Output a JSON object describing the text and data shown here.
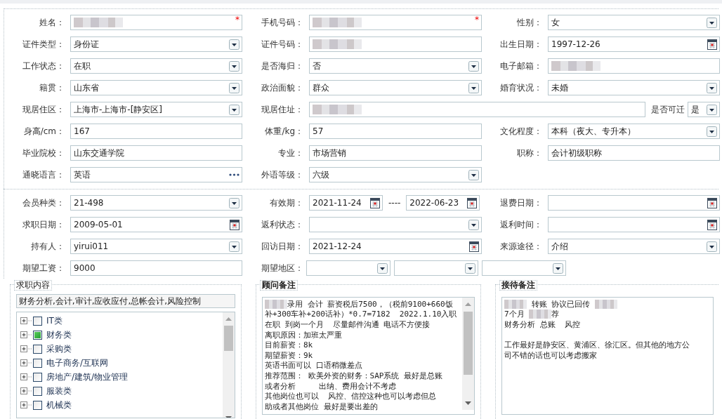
{
  "personal": {
    "fields": [
      {
        "label": "姓名：",
        "kind": "text",
        "redacted": true,
        "marker": "*"
      },
      {
        "label": "手机号码：",
        "kind": "text",
        "redacted": true,
        "marker": "*"
      },
      {
        "label": "性别：",
        "kind": "select",
        "value": "女"
      },
      {
        "label": "证件类型：",
        "kind": "select",
        "value": "身份证"
      },
      {
        "label": "证件号码：",
        "kind": "text",
        "redacted": true
      },
      {
        "label": "出生日期：",
        "kind": "date",
        "value": "1997-12-26"
      },
      {
        "label": "工作状态：",
        "kind": "select",
        "value": "在职"
      },
      {
        "label": "是否海归：",
        "kind": "select",
        "value": "否"
      },
      {
        "label": "电子邮箱：",
        "kind": "text",
        "redacted": true
      },
      {
        "label": "籍贯：",
        "kind": "select",
        "value": "山东省"
      },
      {
        "label": "政治面貌：",
        "kind": "select",
        "value": "群众"
      },
      {
        "label": "婚育状况：",
        "kind": "select",
        "value": "未婚"
      },
      {
        "label": "现居住区：",
        "kind": "select",
        "value": "上海市-上海市-[静安区]"
      },
      {
        "label": "现居住址：",
        "kind": "text",
        "redacted": true,
        "wide": true,
        "suffix": {
          "label": "是否可迁",
          "kind": "select",
          "value": "是"
        }
      },
      {
        "label": "身高/cm：",
        "kind": "text",
        "value": "167"
      },
      {
        "label": "体重/kg：",
        "kind": "text",
        "value": "57"
      },
      {
        "label": "文化程度：",
        "kind": "select",
        "value": "本科（夜大、专升本）"
      },
      {
        "label": "毕业院校：",
        "kind": "text",
        "value": "山东交通学院"
      },
      {
        "label": "专业：",
        "kind": "text",
        "value": "市场营销"
      },
      {
        "label": "职称：",
        "kind": "text",
        "value": "会计初级职称"
      },
      {
        "label": "通晓语言：",
        "kind": "picker",
        "value": "英语"
      },
      {
        "label": "外语等级：",
        "kind": "select",
        "value": "六级"
      }
    ]
  },
  "membership": {
    "fields": [
      {
        "label": "会员种类：",
        "kind": "select",
        "value": "21-498"
      },
      {
        "label": "有效期：",
        "kind": "daterange",
        "values": [
          "2021-11-24",
          "2022-06-23"
        ],
        "separator": "----"
      },
      {
        "label": "退费日期：",
        "kind": "date"
      },
      {
        "label": "求职日期：",
        "kind": "date",
        "value": "2009-05-01"
      },
      {
        "label": "返利状态：",
        "kind": "select"
      },
      {
        "label": "返利时间：",
        "kind": "date"
      },
      {
        "label": "持有人：",
        "kind": "select",
        "value": "yirui011"
      },
      {
        "label": "回访日期：",
        "kind": "date",
        "value": "2021-12-24"
      },
      {
        "label": "来源途径：",
        "kind": "select",
        "value": "介绍"
      },
      {
        "label": "期望工资：",
        "kind": "text",
        "value": "9000"
      },
      {
        "label": "期望地区：",
        "kind": "selects",
        "boxes": [
          {
            "kind": "select"
          },
          {
            "kind": "select"
          },
          {
            "kind": "select"
          }
        ]
      }
    ]
  },
  "job_content": {
    "title": "求职内容",
    "summary": "财务分析,会计,审计,应收应付,总帐会计,风险控制",
    "tree": [
      {
        "label": "IT类",
        "checked": false,
        "expanded": false
      },
      {
        "label": "财务类",
        "checked": true,
        "expanded": false
      },
      {
        "label": "采购类",
        "checked": false,
        "expanded": false
      },
      {
        "label": "电子商务/互联网",
        "checked": false,
        "expanded": false
      },
      {
        "label": "房地产/建筑/物业管理",
        "checked": false,
        "expanded": false
      },
      {
        "label": "服装类",
        "checked": false,
        "expanded": false
      },
      {
        "label": "机械类",
        "checked": false,
        "expanded": false
      }
    ]
  },
  "consultant_notes": {
    "title": "顾问备注",
    "lines": [
      {
        "parts": [
          {
            "kind": "redacted"
          },
          {
            "text": "录用 会计 薪资税后7500，（税前9100+660饭"
          }
        ]
      },
      {
        "parts": [
          {
            "text": "补+300车补+200话补）*0.7=7182  2022.1.10入职"
          }
        ]
      },
      {
        "parts": [
          {
            "text": "在职 到岗一个月  尽量邮件沟通 电话不方便接"
          }
        ]
      },
      {
        "parts": [
          {
            "text": "离职原因：加班太严重"
          }
        ]
      },
      {
        "parts": [
          {
            "text": "目前薪资：8k"
          }
        ]
      },
      {
        "parts": [
          {
            "text": "期望薪资：9k"
          }
        ]
      },
      {
        "parts": [
          {
            "text": "英语书面可以 口语稍微差点"
          }
        ]
      },
      {
        "parts": [
          {
            "text": "推荐范围： 欧美外资的财务：SAP系统 最好是总账"
          }
        ]
      },
      {
        "parts": [
          {
            "text": "或者分析     出纳、费用会计不考虑"
          }
        ]
      },
      {
        "parts": [
          {
            "text": "其他岗位也可以  风控、信控这种也可以考虑但总"
          }
        ]
      },
      {
        "parts": [
          {
            "text": "助或者其他岗位 最好是要出差的"
          }
        ]
      }
    ]
  },
  "reception_notes": {
    "title": "接待备注",
    "lines": [
      {
        "parts": [
          {
            "kind": "redacted"
          },
          {
            "text": " 转账 协议已回传 "
          },
          {
            "kind": "redacted"
          }
        ]
      },
      {
        "parts": [
          {
            "text": "7个月 "
          },
          {
            "kind": "redacted"
          },
          {
            "text": "荐"
          }
        ]
      },
      {
        "parts": [
          {
            "text": "财务分析 总账  风控"
          }
        ]
      },
      {
        "parts": [
          {
            "text": "工作最好是静安区、黄浦区、徐汇区。但其他的地方公"
          }
        ],
        "gap_before": true
      },
      {
        "parts": [
          {
            "text": "司不错的话也可以考虑搬家"
          }
        ]
      }
    ]
  }
}
